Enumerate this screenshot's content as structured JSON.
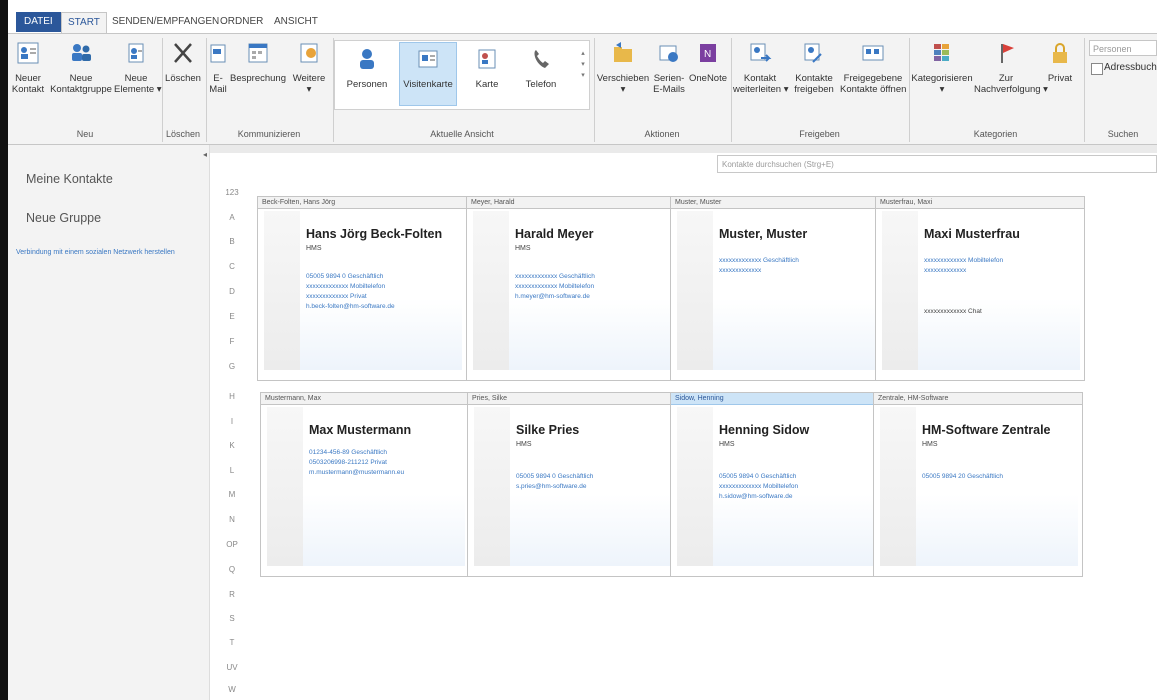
{
  "tabs": [
    "DATEI",
    "START",
    "SENDEN/EMPFANGEN",
    "ORDNER",
    "ANSICHT"
  ],
  "ribbon": {
    "new_contact": [
      "Neuer",
      "Kontakt"
    ],
    "new_group": [
      "Neue",
      "Kontaktgruppe"
    ],
    "new_items": [
      "Neue",
      "Elemente ▾"
    ],
    "group_neu": "Neu",
    "delete": "Löschen",
    "group_loeschen": "Löschen",
    "email": [
      "E-",
      "Mail"
    ],
    "meeting": "Besprechung",
    "more": [
      "Weitere",
      "▾"
    ],
    "group_kommunizieren": "Kommunizieren",
    "view_people": "Personen",
    "view_business_card": "Visitenkarte",
    "view_card": "Karte",
    "view_phone": "Telefon",
    "group_ansicht": "Aktuelle Ansicht",
    "move": [
      "Verschieben",
      "▾"
    ],
    "serial_mail": [
      "Serien-",
      "E-Mails"
    ],
    "onenote": "OneNote",
    "group_aktionen": "Aktionen",
    "forward_contact": [
      "Kontakt",
      "weiterleiten ▾"
    ],
    "share_contacts": [
      "Kontakte",
      "freigeben"
    ],
    "shared_contacts": [
      "Freigegebene",
      "Kontakte öffnen"
    ],
    "group_freigeben": "Freigeben",
    "categorize": [
      "Kategorisieren",
      "▾"
    ],
    "followup": [
      "Zur",
      "Nachverfolgung ▾"
    ],
    "private": "Privat",
    "group_kategorien": "Kategorien",
    "search_people_placeholder": "Personen suchen",
    "address_book": "Adressbuch",
    "group_suchen": "Suchen"
  },
  "nav": {
    "my_contacts": "Meine Kontakte",
    "new_group": "Neue Gruppe",
    "social_link": "Verbindung mit einem sozialen Netzwerk herstellen"
  },
  "search_contacts_placeholder": "Kontakte durchsuchen (Strg+E)",
  "alphabet": [
    "123",
    "A",
    "B",
    "C",
    "D",
    "E",
    "F",
    "G",
    "H",
    "I",
    "K",
    "L",
    "M",
    "N",
    "OP",
    "Q",
    "R",
    "S",
    "T",
    "UV",
    "W"
  ],
  "contacts": [
    {
      "header": "Beck-Folten, Hans Jörg",
      "name": "Hans Jörg Beck-Folten",
      "company": "HMS",
      "lines": [
        "05005 9894 0 Geschäftlich",
        "xxxxxxxxxxxxx Mobiltelefon",
        "xxxxxxxxxxxxx Privat",
        "h.beck-folten@hm-software.de"
      ]
    },
    {
      "header": "Meyer, Harald",
      "name": "Harald Meyer",
      "company": "HMS",
      "lines": [
        "xxxxxxxxxxxxx Geschäftlich",
        "xxxxxxxxxxxxx Mobiltelefon",
        "h.meyer@hm-software.de"
      ]
    },
    {
      "header": "Muster, Muster",
      "name": "Muster, Muster",
      "company": "",
      "lines": [
        "xxxxxxxxxxxxx Geschäftlich",
        "xxxxxxxxxxxxx"
      ]
    },
    {
      "header": "Musterfrau, Maxi",
      "name": "Maxi Musterfrau",
      "company": "",
      "lines": [
        "xxxxxxxxxxxxx Mobiltelefon",
        "xxxxxxxxxxxxx",
        "",
        "xxxxxxxxxxxxx Chat"
      ]
    },
    {
      "header": "Mustermann, Max",
      "name": "Max Mustermann",
      "company": "",
      "lines": [
        "01234-456-89 Geschäftlich",
        "0503206998-211212 Privat",
        "m.mustermann@mustermann.eu"
      ]
    },
    {
      "header": "Pries, Silke",
      "name": "Silke Pries",
      "company": "HMS",
      "lines": [
        "",
        "05005 9894 0 Geschäftlich",
        "s.pries@hm-software.de"
      ]
    },
    {
      "header": "Sidow, Henning",
      "name": "Henning Sidow",
      "company": "HMS",
      "lines": [
        "",
        "05005 9894 0 Geschäftlich",
        "xxxxxxxxxxxxx Mobiltelefon",
        "h.sidow@hm-software.de"
      ]
    },
    {
      "header": "Zentrale, HM-Software",
      "name": "HM-Software Zentrale",
      "company": "HMS",
      "lines": [
        "",
        "05005 9894 20 Geschäftlich"
      ]
    }
  ]
}
